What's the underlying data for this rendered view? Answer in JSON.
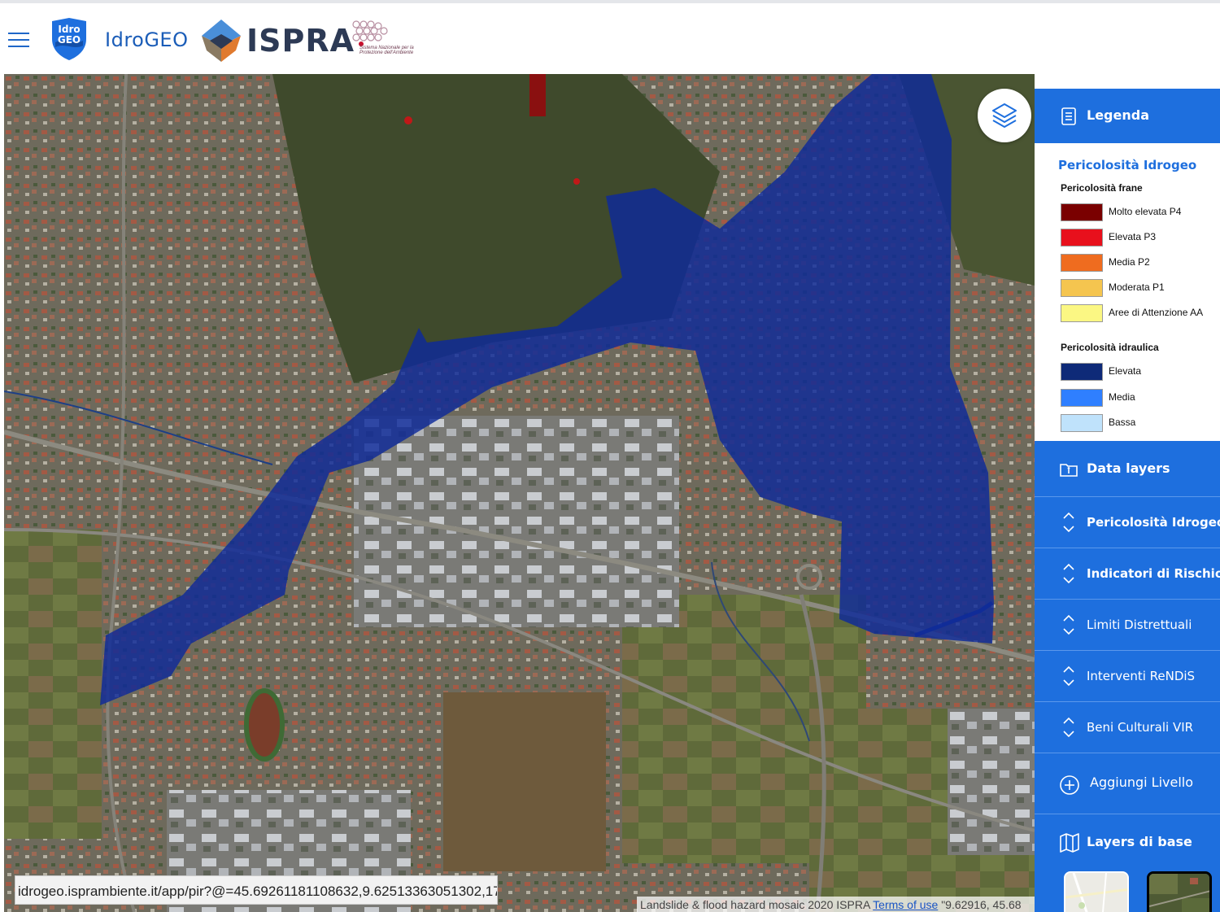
{
  "header": {
    "logo_text": "Idro GEO",
    "app_name": "IdroGEO",
    "org_name": "ISPRA",
    "partner_text": "Sistema Nazionale per la Protezione dell'Ambiente"
  },
  "map": {
    "url": "idrogeo.isprambiente.it/app/pir?@=45.69261181108632,9.62513363051302,17",
    "attribution_text": "Landslide & flood hazard mosaic 2020 ISPRA",
    "attribution_link": "Terms of use",
    "coordinates_text": "\"9.62916, 45.68"
  },
  "legend": {
    "header": "Legenda",
    "title": "Pericolosità Idrogeo",
    "frane_title": "Pericolosità frane",
    "frane": [
      {
        "label": "Molto elevata P4",
        "color": "#7a0000"
      },
      {
        "label": "Elevata P3",
        "color": "#e8101c"
      },
      {
        "label": "Media P2",
        "color": "#ef6c1f"
      },
      {
        "label": "Moderata P1",
        "color": "#f5c54f"
      },
      {
        "label": "Aree di Attenzione AA",
        "color": "#fbf783"
      }
    ],
    "idraulica_title": "Pericolosità idraulica",
    "idraulica": [
      {
        "label": "Elevata",
        "color": "#0e2a78"
      },
      {
        "label": "Media",
        "color": "#2f7fff"
      },
      {
        "label": "Bassa",
        "color": "#bfe2fb"
      }
    ]
  },
  "panel": {
    "data_layers": "Data layers",
    "items": [
      {
        "label": "Pericolosità Idrogeo"
      },
      {
        "label": "Indicatori di Rischio"
      },
      {
        "label": "Limiti Distrettuali"
      },
      {
        "label": "Interventi ReNDiS"
      },
      {
        "label": "Beni Culturali VIR"
      }
    ],
    "add_layer": "Aggiungi Livello",
    "base_layers": "Layers di base"
  },
  "colors": {
    "accent": "#1e6fde",
    "flood_high": "#0e2a78"
  }
}
